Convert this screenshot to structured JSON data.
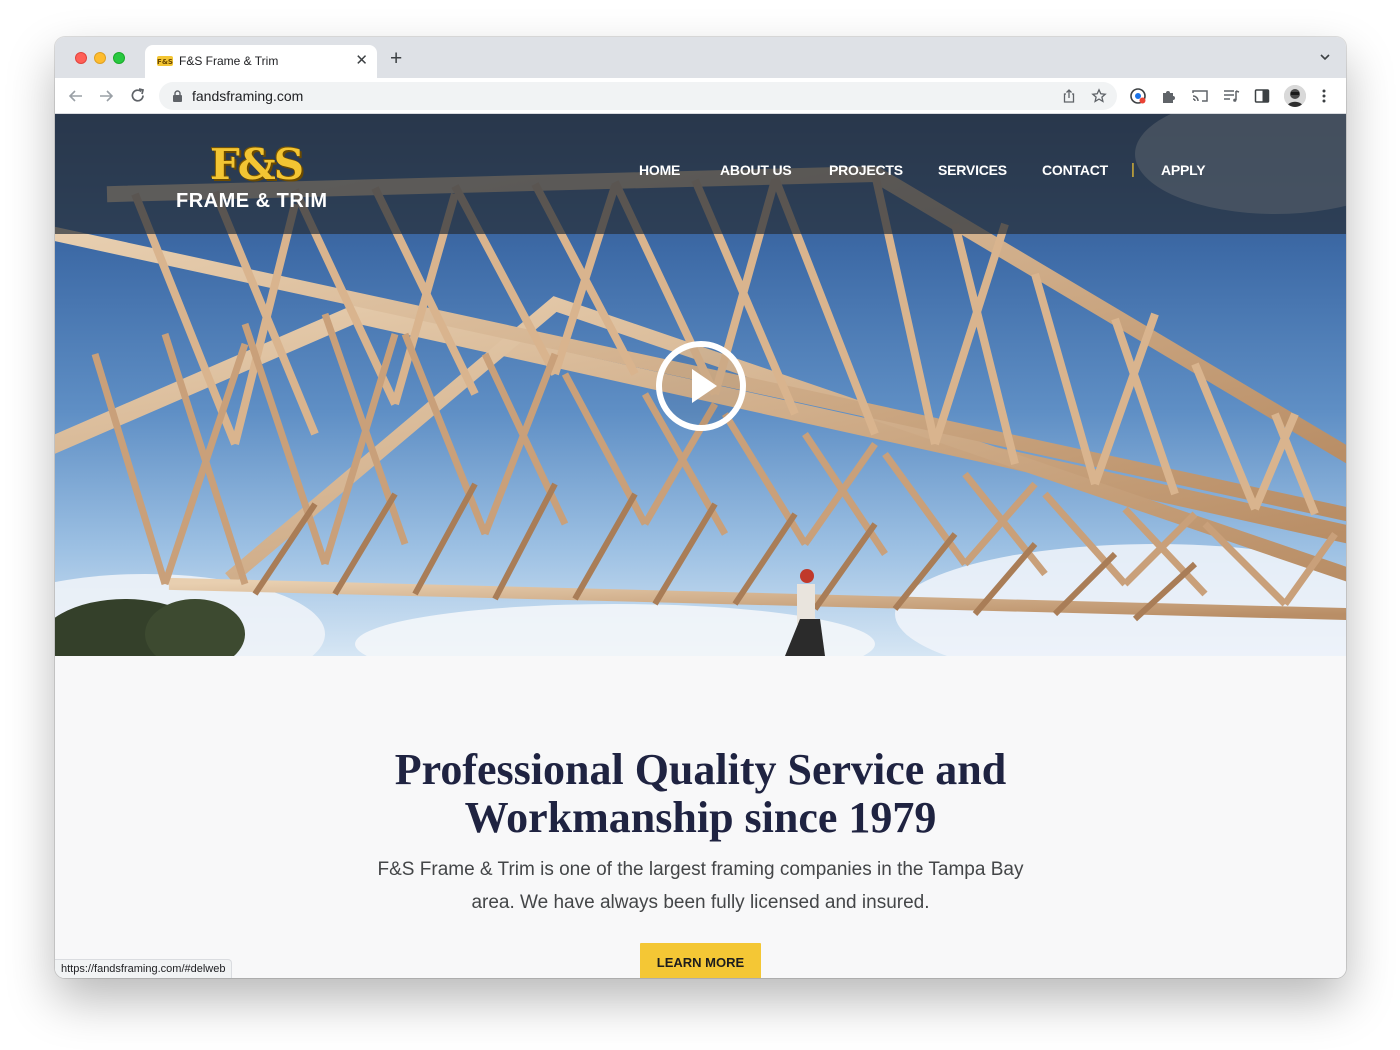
{
  "browser": {
    "tab": {
      "title": "F&S Frame & Trim",
      "favicon_text": "F&S"
    },
    "url": "fandsframing.com",
    "status_url": "https://fandsframing.com/#delweb"
  },
  "site": {
    "logo": {
      "mark": "F&S",
      "text": "FRAME & TRIM"
    },
    "nav": [
      {
        "label": "HOME"
      },
      {
        "label": "ABOUT US"
      },
      {
        "label": "PROJECTS"
      },
      {
        "label": "SERVICES"
      },
      {
        "label": "CONTACT"
      },
      {
        "label": "APPLY"
      }
    ],
    "nav_separator": "|",
    "hero": {
      "play_icon": "play-circle-icon"
    },
    "headline_line1": "Professional Quality Service and",
    "headline_line2": "Workmanship since 1979",
    "subtext_line1": "F&S Frame & Trim is one of the largest framing companies in the Tampa Bay",
    "subtext_line2": "area. We have always been fully licensed and insured.",
    "cta_label": "LEARN MORE"
  },
  "colors": {
    "accent": "#f4c735",
    "headline": "#1f2341",
    "header_overlay": "#28303a"
  }
}
